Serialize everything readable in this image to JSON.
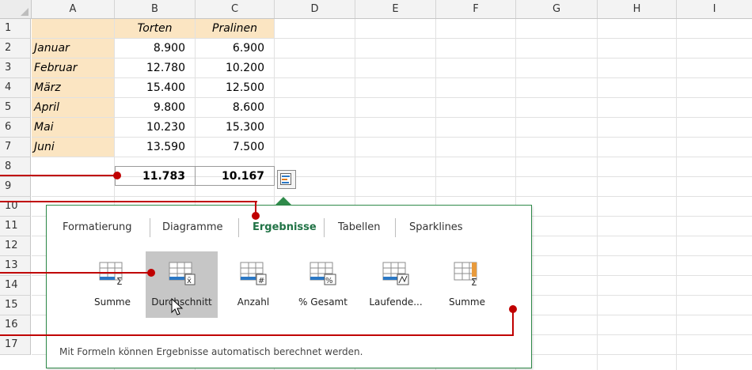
{
  "columns": [
    "A",
    "B",
    "C",
    "D",
    "E",
    "F",
    "G",
    "H",
    "I"
  ],
  "rows": [
    "1",
    "2",
    "3",
    "4",
    "5",
    "6",
    "7",
    "8",
    "9",
    "10",
    "11",
    "12",
    "13",
    "14",
    "15",
    "16",
    "17"
  ],
  "table": {
    "header": {
      "b": "Torten",
      "c": "Pralinen"
    },
    "data": [
      {
        "label": "Januar",
        "b": "8.900",
        "c": "6.900"
      },
      {
        "label": "Februar",
        "b": "12.780",
        "c": "10.200"
      },
      {
        "label": "März",
        "b": "15.400",
        "c": "12.500"
      },
      {
        "label": "April",
        "b": "9.800",
        "c": "8.600"
      },
      {
        "label": "Mai",
        "b": "10.230",
        "c": "15.300"
      },
      {
        "label": "Juni",
        "b": "13.590",
        "c": "7.500"
      }
    ],
    "totals": {
      "b": "11.783",
      "c": "10.167"
    }
  },
  "quick_analysis": {
    "button_icon": "quick-analysis-icon",
    "tabs": [
      "Formatierung",
      "Diagramme",
      "Ergebnisse",
      "Tabellen",
      "Sparklines"
    ],
    "active_tab": "Ergebnisse",
    "tools": [
      {
        "label": "Summe",
        "icon": "sum-rows-icon"
      },
      {
        "label": "Durchschnitt",
        "icon": "average-icon",
        "selected": true
      },
      {
        "label": "Anzahl",
        "icon": "count-icon"
      },
      {
        "label": "% Gesamt",
        "icon": "percent-total-icon"
      },
      {
        "label": "Laufende...",
        "icon": "running-total-icon"
      },
      {
        "label": "Summe",
        "icon": "sum-columns-icon"
      }
    ],
    "footer": "Mit Formeln können Ergebnisse automatisch berechnet werden.",
    "accent_color": "#217346",
    "callout_color": "#c00000"
  }
}
